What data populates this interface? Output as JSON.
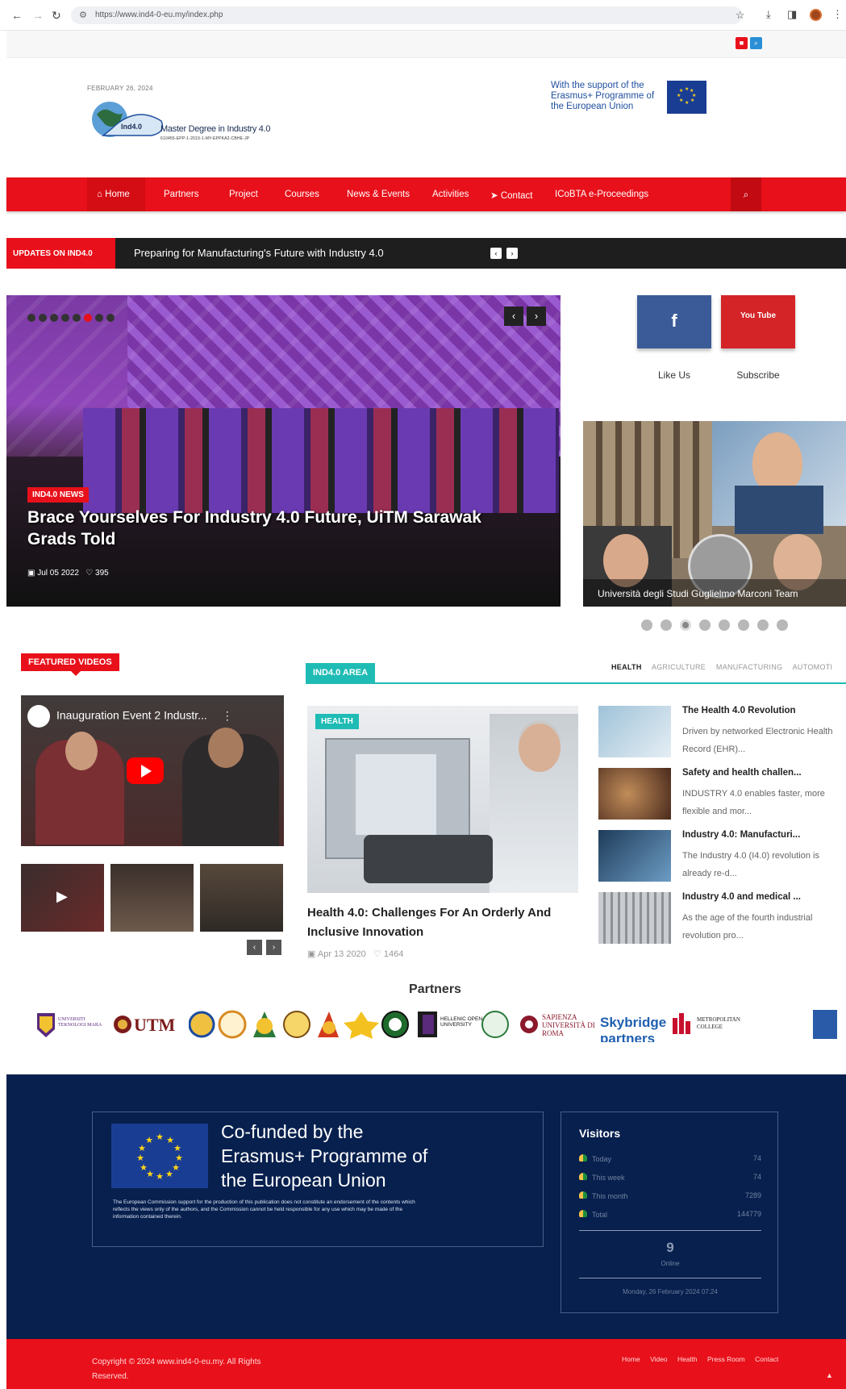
{
  "browser": {
    "url": "https://www.ind4-0-eu.my/index.php"
  },
  "header": {
    "date": "FEBRUARY 26, 2024",
    "logo_mark": "Ind4.0",
    "logo_title": "Master Degree in Industry 4.0",
    "logo_sub": "610455-EPP-1-2019-1-MY-EPPKA2-CBHE-JP",
    "eu_support": "With the support of the Erasmus+ Programme of the European Union"
  },
  "nav": {
    "items": [
      "Home",
      "Partners",
      "Project",
      "Courses",
      "News & Events",
      "Activities",
      "Contact",
      "ICoBTA e-Proceedings"
    ]
  },
  "ticker": {
    "label": "UPDATES ON IND4.0",
    "text": "Preparing for Manufacturing's Future with Industry 4.0"
  },
  "hero": {
    "badge": "IND4.0 NEWS",
    "title": "Brace Yourselves For Industry 4.0 Future, UiTM Sarawak Grads Told",
    "date": "Jul 05 2022",
    "likes": "395"
  },
  "social": {
    "facebook_label": "Like Us",
    "youtube_label": "Subscribe",
    "youtube_glyph": "You Tube"
  },
  "side_slide": {
    "caption": "Università degli Studi Guglielmo Marconi Team"
  },
  "featured_videos": {
    "label": "FEATURED VIDEOS",
    "video_title": "Inauguration Event 2 Industr..."
  },
  "ind_area": {
    "label": "IND4.0 AREA",
    "tabs": [
      "HEALTH",
      "AGRICULTURE",
      "MANUFACTURING",
      "AUTOMOTI"
    ],
    "main": {
      "tag": "HEALTH",
      "title": "Health 4.0: Challenges For An Orderly And Inclusive Innovation",
      "date": "Apr 13 2020",
      "likes": "1464"
    },
    "items": [
      {
        "title": "The Health 4.0 Revolution",
        "desc": "Driven by networked Electronic Health Record (EHR)..."
      },
      {
        "title": "Safety and health challen...",
        "desc": "INDUSTRY 4.0 enables faster, more flexible and mor..."
      },
      {
        "title": "Industry 4.0: Manufacturi...",
        "desc": "The Industry 4.0 (I4.0) revolution is already re-d..."
      },
      {
        "title": "Industry 4.0 and medical ...",
        "desc": "As the age of the fourth industrial revolution pro..."
      }
    ]
  },
  "partners": {
    "heading": "Partners",
    "logos": [
      "UNIVERSITI TEKNOLOGI MARA",
      "UTM",
      "HELLENIC OPEN UNIVERSITY",
      "SAPIENZA UNIVERSITÀ DI ROMA",
      "Skybridge partners",
      "METROPOLITAN COLLEGE"
    ]
  },
  "footer": {
    "cofund_title": "Co-funded by the Erasmus+ Programme of the European Union",
    "cofund_disclaimer": "The European Commission support for the production of this publication does not constitute an endorsement of the contents which reflects the views only of the authors, and the Commission cannot be held responsible for any use which may be made of the information contained therein.",
    "visitors": {
      "heading": "Visitors",
      "rows": [
        {
          "label": "Today",
          "value": "74"
        },
        {
          "label": "This week",
          "value": "74"
        },
        {
          "label": "This month",
          "value": "7289"
        },
        {
          "label": "Total",
          "value": "144779"
        }
      ],
      "online_count": "9",
      "online_label": "Online",
      "date": "Monday, 26 February 2024 07:24"
    },
    "copyright": "Copyright © 2024 www.ind4-0-eu.my. All Rights Reserved.",
    "links": [
      "Home",
      "Video",
      "Health",
      "Press Room",
      "Contact"
    ]
  },
  "colors": {
    "brand_red": "#e8101a",
    "teal": "#1fbcb5",
    "footer_navy": "#07204e"
  }
}
